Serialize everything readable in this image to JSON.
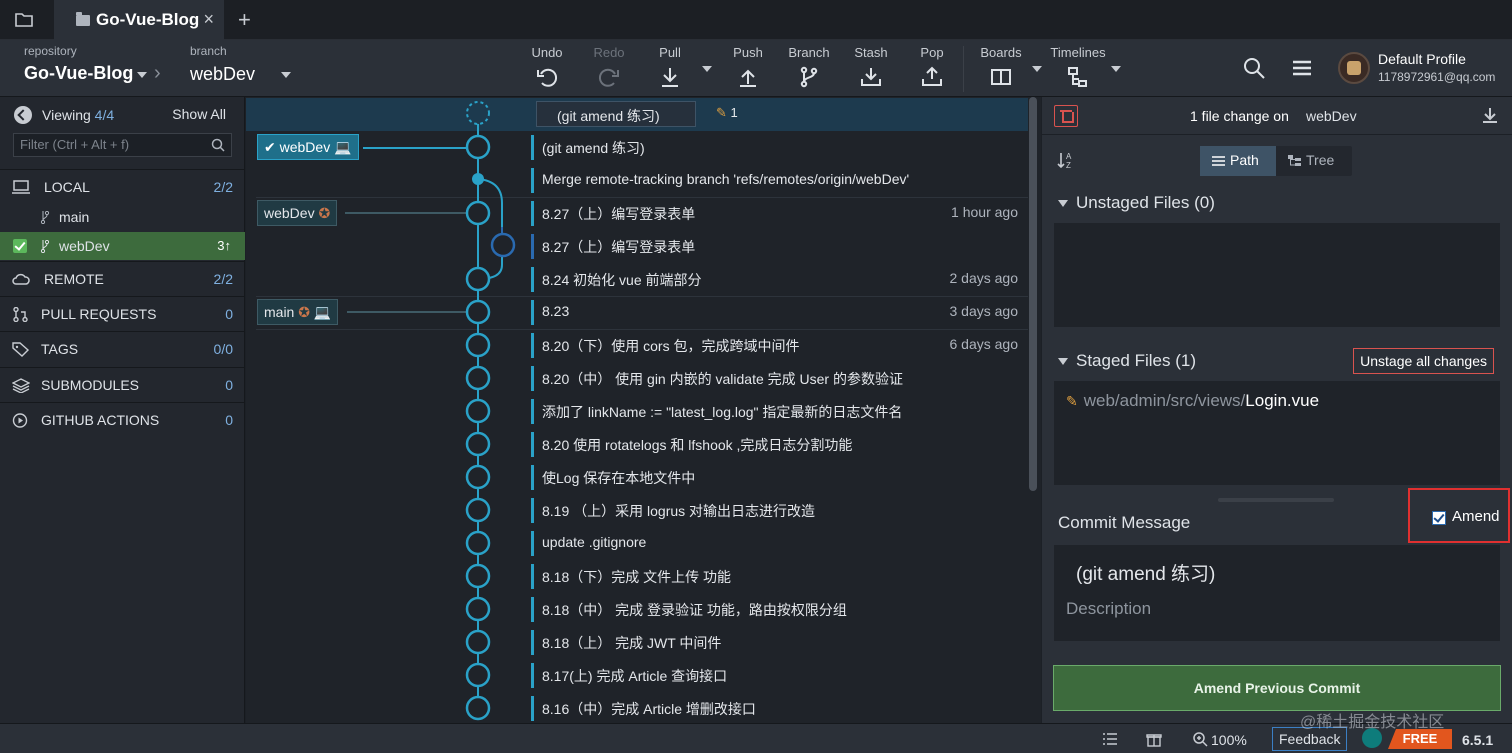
{
  "tabs": [
    {
      "label": "Go-Vue-Blog"
    }
  ],
  "toolbar": {
    "repository_label": "repository",
    "repository_name": "Go-Vue-Blog",
    "branch_label": "branch",
    "branch_name": "webDev",
    "buttons": {
      "undo": "Undo",
      "redo": "Redo",
      "pull": "Pull",
      "push": "Push",
      "branch": "Branch",
      "stash": "Stash",
      "pop": "Pop",
      "boards": "Boards",
      "timelines": "Timelines"
    },
    "profile_name": "Default Profile",
    "profile_email": "1178972961@qq.com"
  },
  "sidebar": {
    "viewing_label": "Viewing",
    "viewing_count": "4/4",
    "show_all": "Show All",
    "filter_placeholder": "Filter (Ctrl + Alt + f)",
    "local": {
      "label": "LOCAL",
      "count": "2/2"
    },
    "local_branches": [
      {
        "name": "main",
        "active": false,
        "ahead": ""
      },
      {
        "name": "webDev",
        "active": true,
        "ahead": "3↑"
      }
    ],
    "remote": {
      "label": "REMOTE",
      "count": "2/2"
    },
    "pull_requests": {
      "label": "PULL REQUESTS",
      "count": "0"
    },
    "tags": {
      "label": "TAGS",
      "count": "0/0"
    },
    "submodules": {
      "label": "SUBMODULES",
      "count": "0"
    },
    "github_actions": {
      "label": "GITHUB ACTIONS",
      "count": "0"
    }
  },
  "graph": {
    "wip": {
      "message": "(git amend 练习)",
      "count": "1"
    },
    "refs": {
      "webdev_local": "webDev",
      "webdev_remote": "webDev",
      "main": "main"
    },
    "commits": [
      {
        "message": "(git amend 练习)",
        "time": ""
      },
      {
        "message": "Merge remote-tracking branch 'refs/remotes/origin/webDev'",
        "time": ""
      },
      {
        "message": "8.27（上）编写登录表单",
        "time": "1 hour ago"
      },
      {
        "message": "8.27（上）编写登录表单",
        "time": ""
      },
      {
        "message": "8.24 初始化 vue 前端部分",
        "time": "2 days ago"
      },
      {
        "message": "8.23",
        "time": "3 days ago"
      },
      {
        "message": "8.20（下）使用 cors 包，完成跨域中间件",
        "time": "6 days ago"
      },
      {
        "message": "8.20（中） 使用 gin 内嵌的 validate 完成 User 的参数验证",
        "time": ""
      },
      {
        "message": "添加了 linkName := \"latest_log.log\" 指定最新的日志文件名",
        "time": ""
      },
      {
        "message": "8.20 使用 rotatelogs 和 lfshook ,完成日志分割功能",
        "time": ""
      },
      {
        "message": "使Log 保存在本地文件中",
        "time": ""
      },
      {
        "message": "8.19 （上）采用 logrus 对输出日志进行改造",
        "time": ""
      },
      {
        "message": "update .gitignore",
        "time": ""
      },
      {
        "message": "8.18（下）完成 文件上传 功能",
        "time": ""
      },
      {
        "message": "8.18（中） 完成 登录验证 功能，路由按权限分组",
        "time": ""
      },
      {
        "message": "8.18（上） 完成 JWT 中间件",
        "time": ""
      },
      {
        "message": "8.17(上) 完成 Article 查询接口",
        "time": ""
      },
      {
        "message": "8.16（中）完成 Article 增删改接口",
        "time": ""
      }
    ]
  },
  "right_panel": {
    "file_change_text": "1 file change on",
    "branch": "webDev",
    "view_path": "Path",
    "view_tree": "Tree",
    "unstaged_title": "Unstaged Files (0)",
    "staged_title": "Staged Files (1)",
    "unstage_all": "Unstage all changes",
    "staged_file_dir": "web/admin/src/views/",
    "staged_file_name": "Login.vue",
    "commit_message_label": "Commit Message",
    "amend_label": "Amend",
    "amend_checked": true,
    "summary_value": "(git amend 练习)",
    "description_placeholder": "Description",
    "commit_button": "Amend Previous Commit"
  },
  "statusbar": {
    "zoom": "100%",
    "feedback": "Feedback",
    "free": "FREE",
    "version": "6.5.1"
  },
  "watermark": "@稀土掘金技术社区",
  "colors": {
    "accent": "#2aa2c8",
    "branch_active": "#3d6b3d",
    "danger": "#d9534f",
    "free": "#e2561e"
  }
}
